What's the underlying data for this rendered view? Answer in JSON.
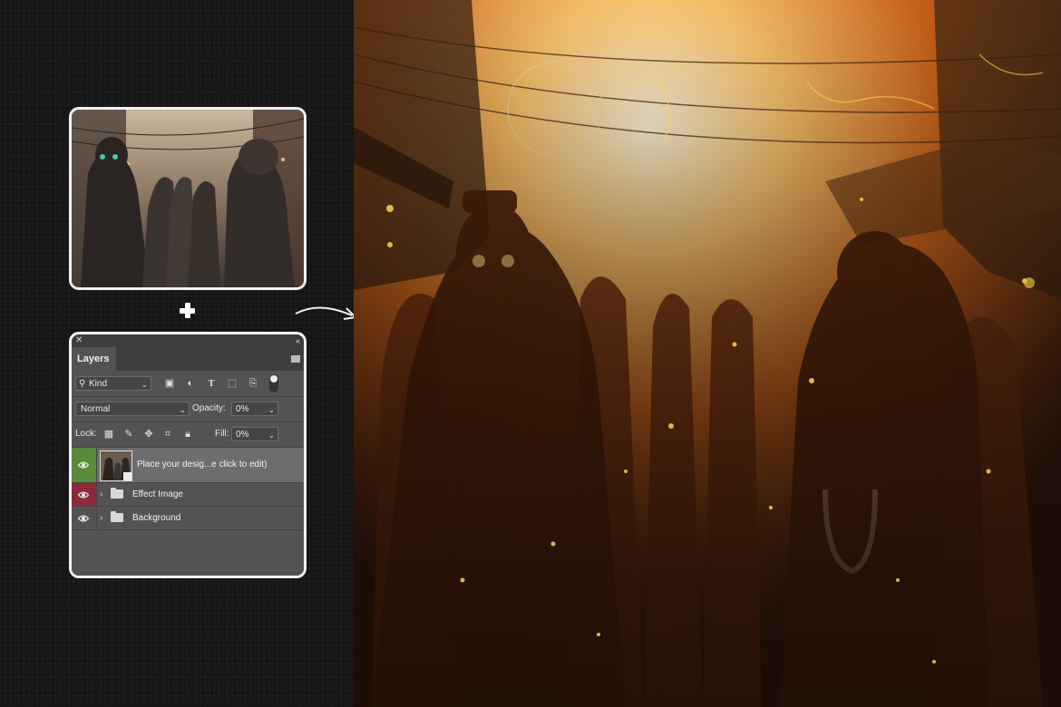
{
  "layers_panel": {
    "tab_label": "Layers",
    "filter": {
      "kind_label": "Kind"
    },
    "blend_mode": "Normal",
    "opacity_label": "Opacity:",
    "opacity_value": "0%",
    "lock_label": "Lock:",
    "fill_label": "Fill:",
    "fill_value": "0%",
    "layers": [
      {
        "name": "Place your desig...e click to edit)",
        "type": "smart-object",
        "visible": true,
        "eye_color": "#5a8a3c",
        "selected": true
      },
      {
        "name": "Effect Image",
        "type": "group",
        "visible": true,
        "eye_color": "#8a2a3a",
        "selected": false
      },
      {
        "name": "Background",
        "type": "group",
        "visible": true,
        "eye_color": "none",
        "selected": false
      }
    ]
  },
  "colors": {
    "background": "#141414",
    "panel": "#535353",
    "card_border": "#f2f2f2",
    "result_glow": "#f6c06a"
  }
}
